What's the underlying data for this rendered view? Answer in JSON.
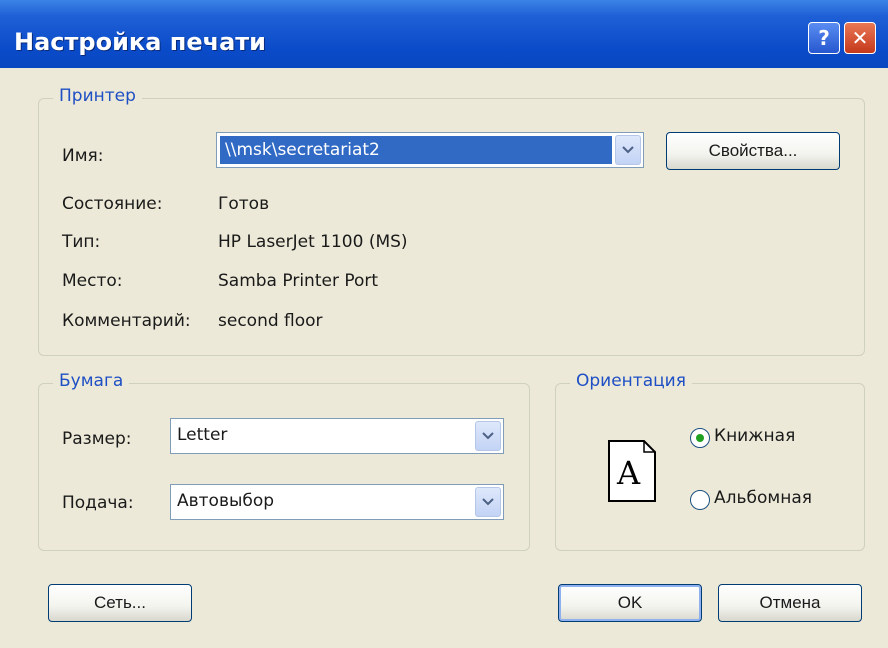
{
  "window": {
    "title": "Настройка печати"
  },
  "titlebar_buttons": {
    "help": "?",
    "close": "✕"
  },
  "printer": {
    "group_label": "Принтер",
    "name_label": "Имя:",
    "name_value": "\\\\msk\\secretariat2",
    "properties_button": "Свойства...",
    "status_label": "Состояние:",
    "status_value": "Готов",
    "type_label": "Тип:",
    "type_value": "HP LaserJet 1100 (MS)",
    "where_label": "Место:",
    "where_value": "Samba Printer Port",
    "comment_label": "Комментарий:",
    "comment_value": "second floor"
  },
  "paper": {
    "group_label": "Бумага",
    "size_label": "Размер:",
    "size_value": "Letter",
    "source_label": "Подача:",
    "source_value": "Автовыбор"
  },
  "orientation": {
    "group_label": "Ориентация",
    "preview_letter": "A",
    "portrait_label": "Книжная",
    "landscape_label": "Альбомная",
    "selected": "portrait"
  },
  "buttons": {
    "network": "Сеть...",
    "ok": "OK",
    "cancel": "Отмена"
  },
  "colors": {
    "titlebar": "#0a4bc9",
    "legend": "#1e4fc4",
    "selection": "#316ac5",
    "dialog": "#ece9d8"
  }
}
